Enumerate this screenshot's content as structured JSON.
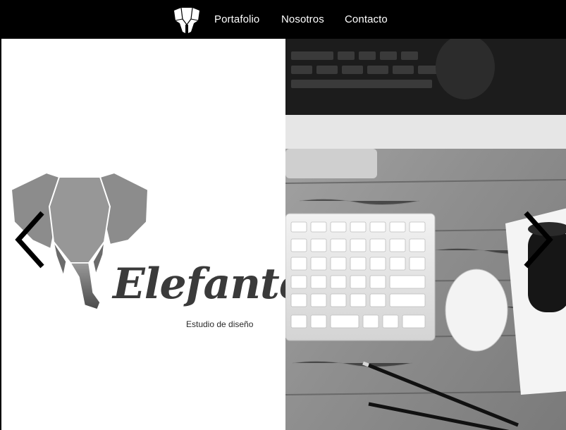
{
  "nav": {
    "logo_icon": "elephant-logo-icon",
    "links": [
      "Portafolio",
      "Nosotros",
      "Contacto"
    ]
  },
  "hero": {
    "brand_name": "Elefante",
    "tagline": "Estudio de diseño",
    "logo_icon": "geometric-elephant-icon",
    "photo_subject": "desk-workspace-photo"
  },
  "carousel": {
    "prev_icon": "chevron-left-icon",
    "next_icon": "chevron-right-icon"
  },
  "colors": {
    "nav_bg": "#000000",
    "nav_text": "#ffffff",
    "brand_text": "#3a3a3a",
    "elephant_gray": "#8a8a8a"
  }
}
